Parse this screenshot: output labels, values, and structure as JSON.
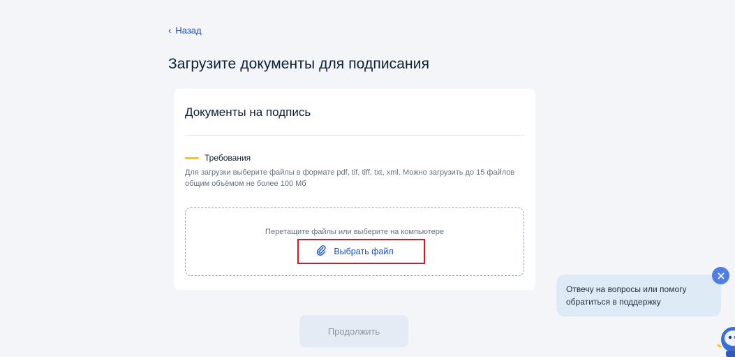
{
  "nav": {
    "back_label": "Назад"
  },
  "page": {
    "title": "Загрузите документы для подписания"
  },
  "card": {
    "title": "Документы на подпись",
    "requirements_title": "Требования",
    "requirements_text": "Для загрузки выберите файлы в формате pdf, tif, tiff, txt, xml. Можно загрузить до 15 файлов общим объёмом не более 100 Мб",
    "dropzone_hint": "Перетащите файлы или выберите на компьютере",
    "choose_file_label": "Выбрать файл"
  },
  "actions": {
    "continue_label": "Продолжить"
  },
  "chat": {
    "message": "Отвечу на вопросы или помогу обратиться в поддержку"
  },
  "icons": {
    "back": "chevron-left-icon",
    "attach": "paperclip-icon",
    "close": "close-icon",
    "assistant": "robot-assistant-icon"
  },
  "colors": {
    "link": "#0d4cd3",
    "accent_bar": "#f5c518",
    "highlight": "#e0141e",
    "background": "#f3f5f9"
  }
}
